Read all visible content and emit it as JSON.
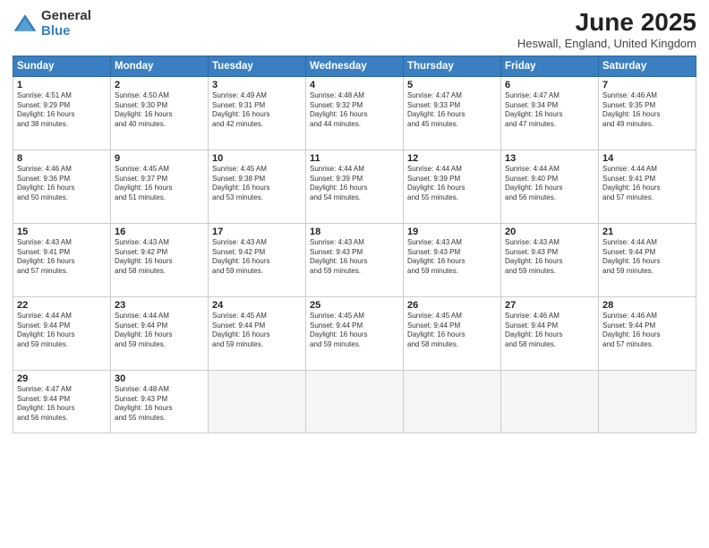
{
  "logo": {
    "general": "General",
    "blue": "Blue"
  },
  "title": "June 2025",
  "location": "Heswall, England, United Kingdom",
  "days_of_week": [
    "Sunday",
    "Monday",
    "Tuesday",
    "Wednesday",
    "Thursday",
    "Friday",
    "Saturday"
  ],
  "weeks": [
    [
      {
        "day": "1",
        "info": "Sunrise: 4:51 AM\nSunset: 9:29 PM\nDaylight: 16 hours\nand 38 minutes."
      },
      {
        "day": "2",
        "info": "Sunrise: 4:50 AM\nSunset: 9:30 PM\nDaylight: 16 hours\nand 40 minutes."
      },
      {
        "day": "3",
        "info": "Sunrise: 4:49 AM\nSunset: 9:31 PM\nDaylight: 16 hours\nand 42 minutes."
      },
      {
        "day": "4",
        "info": "Sunrise: 4:48 AM\nSunset: 9:32 PM\nDaylight: 16 hours\nand 44 minutes."
      },
      {
        "day": "5",
        "info": "Sunrise: 4:47 AM\nSunset: 9:33 PM\nDaylight: 16 hours\nand 45 minutes."
      },
      {
        "day": "6",
        "info": "Sunrise: 4:47 AM\nSunset: 9:34 PM\nDaylight: 16 hours\nand 47 minutes."
      },
      {
        "day": "7",
        "info": "Sunrise: 4:46 AM\nSunset: 9:35 PM\nDaylight: 16 hours\nand 49 minutes."
      }
    ],
    [
      {
        "day": "8",
        "info": "Sunrise: 4:46 AM\nSunset: 9:36 PM\nDaylight: 16 hours\nand 50 minutes."
      },
      {
        "day": "9",
        "info": "Sunrise: 4:45 AM\nSunset: 9:37 PM\nDaylight: 16 hours\nand 51 minutes."
      },
      {
        "day": "10",
        "info": "Sunrise: 4:45 AM\nSunset: 9:38 PM\nDaylight: 16 hours\nand 53 minutes."
      },
      {
        "day": "11",
        "info": "Sunrise: 4:44 AM\nSunset: 9:39 PM\nDaylight: 16 hours\nand 54 minutes."
      },
      {
        "day": "12",
        "info": "Sunrise: 4:44 AM\nSunset: 9:39 PM\nDaylight: 16 hours\nand 55 minutes."
      },
      {
        "day": "13",
        "info": "Sunrise: 4:44 AM\nSunset: 9:40 PM\nDaylight: 16 hours\nand 56 minutes."
      },
      {
        "day": "14",
        "info": "Sunrise: 4:44 AM\nSunset: 9:41 PM\nDaylight: 16 hours\nand 57 minutes."
      }
    ],
    [
      {
        "day": "15",
        "info": "Sunrise: 4:43 AM\nSunset: 9:41 PM\nDaylight: 16 hours\nand 57 minutes."
      },
      {
        "day": "16",
        "info": "Sunrise: 4:43 AM\nSunset: 9:42 PM\nDaylight: 16 hours\nand 58 minutes."
      },
      {
        "day": "17",
        "info": "Sunrise: 4:43 AM\nSunset: 9:42 PM\nDaylight: 16 hours\nand 59 minutes."
      },
      {
        "day": "18",
        "info": "Sunrise: 4:43 AM\nSunset: 9:43 PM\nDaylight: 16 hours\nand 59 minutes."
      },
      {
        "day": "19",
        "info": "Sunrise: 4:43 AM\nSunset: 9:43 PM\nDaylight: 16 hours\nand 59 minutes."
      },
      {
        "day": "20",
        "info": "Sunrise: 4:43 AM\nSunset: 9:43 PM\nDaylight: 16 hours\nand 59 minutes."
      },
      {
        "day": "21",
        "info": "Sunrise: 4:44 AM\nSunset: 9:44 PM\nDaylight: 16 hours\nand 59 minutes."
      }
    ],
    [
      {
        "day": "22",
        "info": "Sunrise: 4:44 AM\nSunset: 9:44 PM\nDaylight: 16 hours\nand 59 minutes."
      },
      {
        "day": "23",
        "info": "Sunrise: 4:44 AM\nSunset: 9:44 PM\nDaylight: 16 hours\nand 59 minutes."
      },
      {
        "day": "24",
        "info": "Sunrise: 4:45 AM\nSunset: 9:44 PM\nDaylight: 16 hours\nand 59 minutes."
      },
      {
        "day": "25",
        "info": "Sunrise: 4:45 AM\nSunset: 9:44 PM\nDaylight: 16 hours\nand 59 minutes."
      },
      {
        "day": "26",
        "info": "Sunrise: 4:45 AM\nSunset: 9:44 PM\nDaylight: 16 hours\nand 58 minutes."
      },
      {
        "day": "27",
        "info": "Sunrise: 4:46 AM\nSunset: 9:44 PM\nDaylight: 16 hours\nand 58 minutes."
      },
      {
        "day": "28",
        "info": "Sunrise: 4:46 AM\nSunset: 9:44 PM\nDaylight: 16 hours\nand 57 minutes."
      }
    ],
    [
      {
        "day": "29",
        "info": "Sunrise: 4:47 AM\nSunset: 9:44 PM\nDaylight: 16 hours\nand 56 minutes."
      },
      {
        "day": "30",
        "info": "Sunrise: 4:48 AM\nSunset: 9:43 PM\nDaylight: 16 hours\nand 55 minutes."
      },
      {
        "day": "",
        "info": ""
      },
      {
        "day": "",
        "info": ""
      },
      {
        "day": "",
        "info": ""
      },
      {
        "day": "",
        "info": ""
      },
      {
        "day": "",
        "info": ""
      }
    ]
  ]
}
